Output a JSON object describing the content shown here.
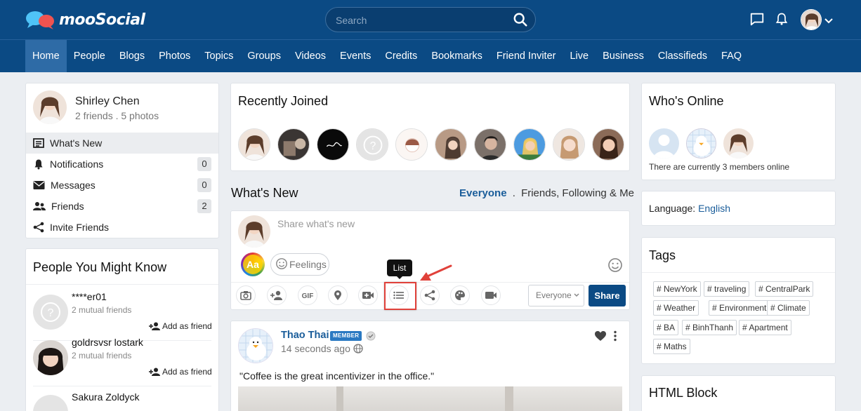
{
  "header": {
    "logo_text": "mooSocial",
    "search_placeholder": "Search"
  },
  "nav": {
    "items": [
      "Home",
      "People",
      "Blogs",
      "Photos",
      "Topics",
      "Groups",
      "Videos",
      "Events",
      "Credits",
      "Bookmarks",
      "Friend Inviter",
      "Live",
      "Business",
      "Classifieds",
      "FAQ"
    ],
    "active": "Home"
  },
  "profile": {
    "name": "Shirley Chen",
    "stats": "2 friends . 5 photos"
  },
  "left_menu": [
    {
      "label": "What's New",
      "icon": "newspaper-icon",
      "count": ""
    },
    {
      "label": "Notifications",
      "icon": "bell-icon",
      "count": "0"
    },
    {
      "label": "Messages",
      "icon": "envelope-icon",
      "count": "0"
    },
    {
      "label": "Friends",
      "icon": "users-icon",
      "count": "2"
    },
    {
      "label": "Invite Friends",
      "icon": "share-icon",
      "count": ""
    }
  ],
  "people_you_might_know": {
    "title": "People You Might Know",
    "add_label": "Add as friend",
    "people": [
      {
        "name": "****er01",
        "mutual": "2 mutual friends"
      },
      {
        "name": "goldrsvsr lostark",
        "mutual": "2 mutual friends"
      },
      {
        "name": "Sakura Zoldyck",
        "mutual": ""
      }
    ]
  },
  "recently_joined": {
    "title": "Recently Joined",
    "count": 10
  },
  "whats_new": {
    "title": "What's New",
    "filter_active": "Everyone",
    "filter_sep": ".",
    "filter_other": "Friends, Following & Me"
  },
  "composer": {
    "placeholder": "Share what's new",
    "aa_label": "Aa",
    "feelings_label": "Feelings",
    "tooltip": "List",
    "privacy_value": "Everyone",
    "share_label": "Share",
    "tools": [
      "camera-icon",
      "tag-user-icon",
      "gif-icon",
      "location-icon",
      "video-add-icon",
      "list-icon",
      "share-icon",
      "palette-icon",
      "video-camera-icon"
    ]
  },
  "post": {
    "author": "Thao Thai",
    "badge": "MEMBER",
    "time": "14 seconds ago",
    "text": "\"Coffee is the great incentivizer in the office.\""
  },
  "whos_online": {
    "title": "Who's Online",
    "status": "There are currently 3 members online"
  },
  "language": {
    "label": "Language:",
    "value": "English"
  },
  "tags": {
    "title": "Tags",
    "items": [
      "# NewYork",
      "# traveling",
      "# CentralPark",
      "# Weather",
      "# Environment",
      "# Climate",
      "# BA",
      "# BinhThanh",
      "# Apartment",
      "# Maths"
    ]
  },
  "html_block": {
    "title": "HTML Block"
  },
  "colors": {
    "header_bg": "#0b4a84",
    "nav_active": "#2e6ba6",
    "share_button": "#0b4a84",
    "highlight_red": "#e0413a"
  }
}
